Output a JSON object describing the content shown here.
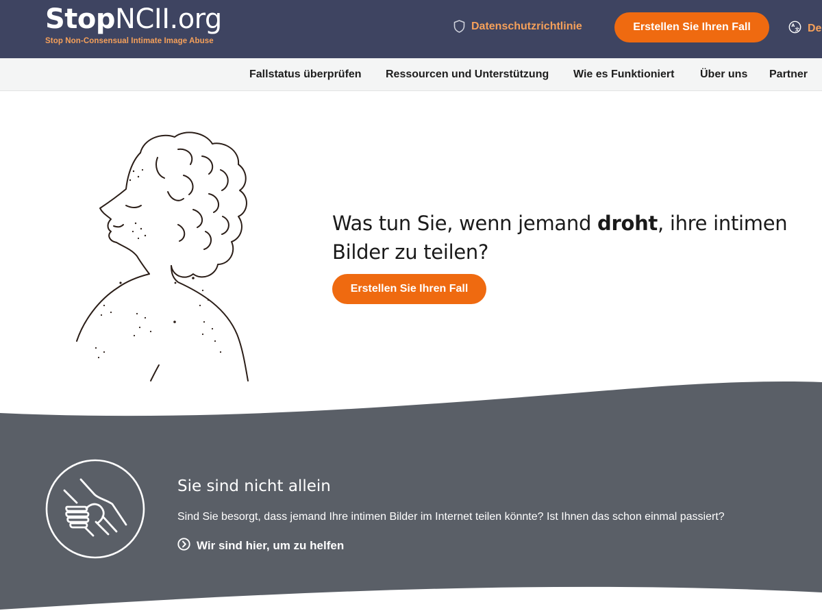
{
  "header": {
    "logo_bold": "Stop",
    "logo_rest": "NCII.org",
    "tagline": "Stop Non-Consensual Intimate Image Abuse",
    "privacy_label": "Datenschutzrichtlinie",
    "create_case_label": "Erstellen Sie Ihren Fall",
    "language_label": "De",
    "icons": {
      "privacy": "shield-icon",
      "language": "translate-icon"
    }
  },
  "nav": {
    "items": [
      {
        "label": "Fallstatus überprüfen"
      },
      {
        "label": "Ressourcen und Unterstützung"
      },
      {
        "label": "Wie es Funktioniert"
      },
      {
        "label": "Über uns"
      },
      {
        "label": "Partner"
      }
    ]
  },
  "hero": {
    "heading_before": "Was tun Sie, wenn jemand ",
    "heading_emphasis": "droht",
    "heading_after": ", ihre intimen Bilder zu teilen?",
    "cta_label": "Erstellen Sie Ihren Fall"
  },
  "help": {
    "icon": "helping-hands-icon",
    "title": "Sie sind nicht allein",
    "text": "Sind Sie besorgt, dass jemand Ihre intimen Bilder im Internet teilen könnte? Ist Ihnen das schon einmal passiert?",
    "link_label": "Wir sind hier, um zu helfen",
    "link_icon": "chevron-right-circle-icon"
  },
  "colors": {
    "header_bg": "#3e4461",
    "accent_orange": "#ef6a10",
    "link_orange": "#f5a05a",
    "section_grey": "#5a5f67",
    "nav_bg": "#f4f5f5"
  }
}
